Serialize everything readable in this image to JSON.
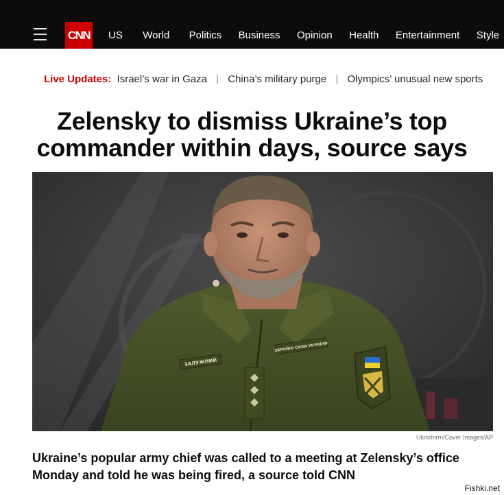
{
  "header": {
    "logo_text": "CNN",
    "nav": [
      "US",
      "World",
      "Politics",
      "Business",
      "Opinion",
      "Health",
      "Entertainment",
      "Style"
    ]
  },
  "live_updates": {
    "label": "Live Updates:",
    "items": [
      "Israel’s war in Gaza",
      "China’s military purge",
      "Olympics’ unusual new sports"
    ]
  },
  "article": {
    "headline_line1": "Zelensky to dismiss Ukraine’s top",
    "headline_line2": "commander within days, source says",
    "photo_credit": "Ukrinform/Cover Images/AP",
    "patch_name": "ЗАЛУЖНИЙ",
    "patch_unit": "ЗБРОЙНІ СИЛИ УКРАЇНИ",
    "lede": "Ukraine’s popular army chief was called to a meeting at Zelensky’s office Monday and told he was being fired, a source told CNN"
  },
  "watermark": "Fishki.net",
  "colors": {
    "brand_red": "#cc0000",
    "topbar": "#0c0c0c"
  }
}
